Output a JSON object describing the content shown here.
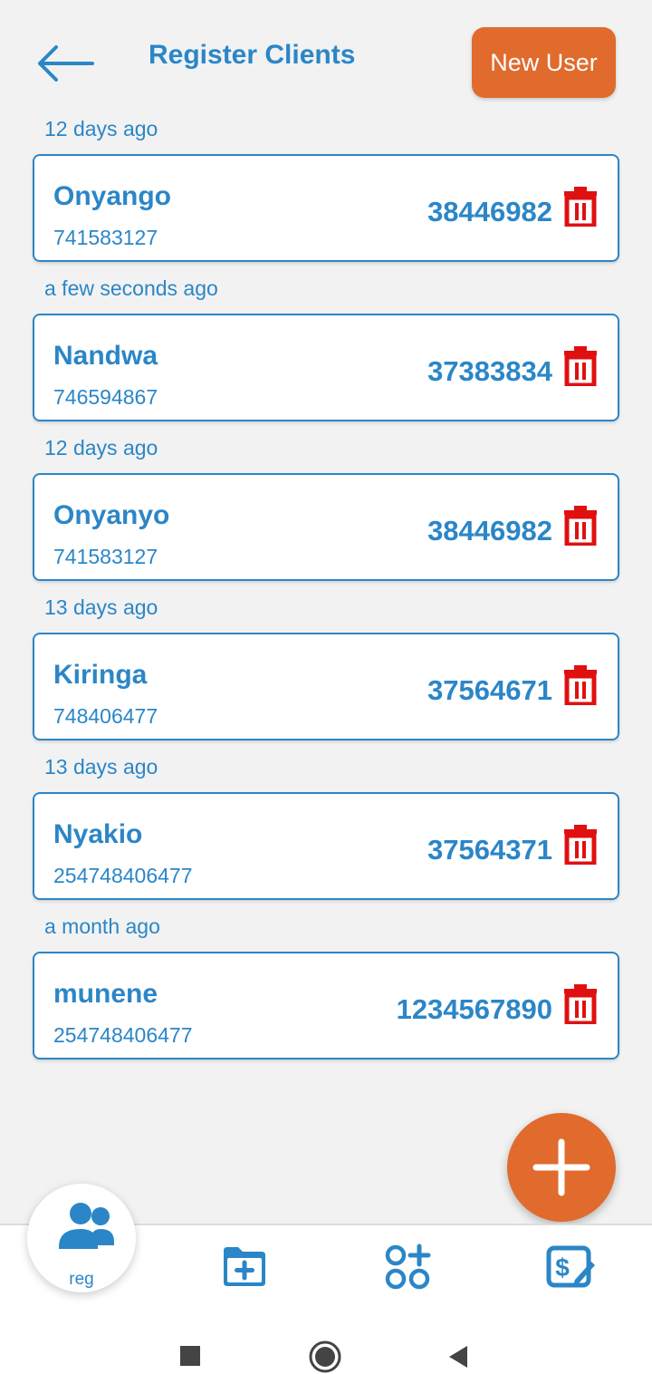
{
  "header": {
    "title": "Register Clients",
    "new_user_label": "New User"
  },
  "clients": [
    {
      "time": "12 days ago",
      "name": "Onyango",
      "phone": "741583127",
      "id_number": "38446982"
    },
    {
      "time": "a few seconds ago",
      "name": "Nandwa",
      "phone": "746594867",
      "id_number": "37383834"
    },
    {
      "time": "12 days ago",
      "name": "Onyanyo",
      "phone": "741583127",
      "id_number": "38446982"
    },
    {
      "time": "13 days ago",
      "name": "Kiringa",
      "phone": "748406477",
      "id_number": "37564671"
    },
    {
      "time": "13 days ago",
      "name": "Nyakio",
      "phone": "254748406477",
      "id_number": "37564371"
    },
    {
      "time": "a month ago",
      "name": "munene",
      "phone": "254748406477",
      "id_number": "1234567890"
    }
  ],
  "bottom_nav": {
    "active_label": "reg"
  },
  "colors": {
    "accent_blue": "#2b86c7",
    "accent_orange": "#e06b2d",
    "delete_red": "#e01010"
  }
}
